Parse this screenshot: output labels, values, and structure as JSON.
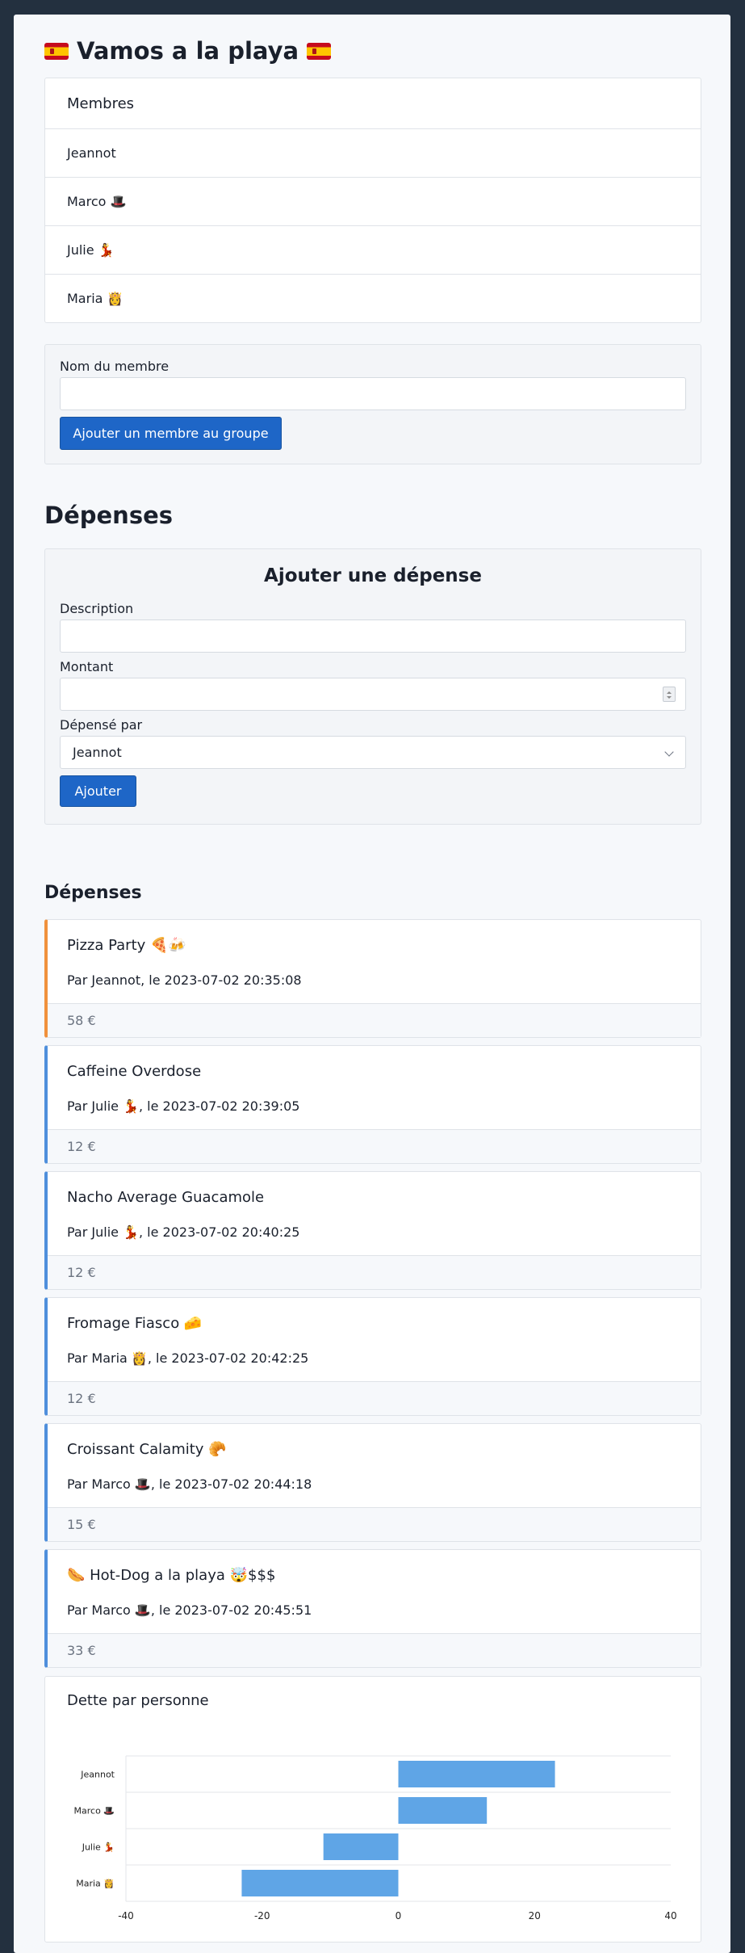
{
  "page_title": "Vamos a la playa",
  "members": {
    "header": "Membres",
    "items": [
      "Jeannot",
      "Marco 🎩",
      "Julie 💃",
      "Maria 👸"
    ]
  },
  "add_member_form": {
    "label": "Nom du membre",
    "input_value": "",
    "button": "Ajouter un membre au groupe"
  },
  "expenses_section_title": "Dépenses",
  "add_expense_form": {
    "title": "Ajouter une dépense",
    "description_label": "Description",
    "description_value": "",
    "amount_label": "Montant",
    "amount_value": "",
    "paid_by_label": "Dépensé par",
    "paid_by_selected": "Jeannot",
    "button": "Ajouter"
  },
  "expense_list_title": "Dépenses",
  "expenses": [
    {
      "title": "Pizza Party 🍕🍻",
      "by": "Par Jeannot, le 2023-07-02 20:35:08",
      "amount": "58 €"
    },
    {
      "title": "Caffeine Overdose",
      "by": "Par Julie 💃, le 2023-07-02 20:39:05",
      "amount": "12 €"
    },
    {
      "title": "Nacho Average Guacamole",
      "by": "Par Julie 💃, le 2023-07-02 20:40:25",
      "amount": "12 €"
    },
    {
      "title": "Fromage Fiasco 🧀",
      "by": "Par Maria 👸, le 2023-07-02 20:42:25",
      "amount": "12 €"
    },
    {
      "title": "Croissant Calamity 🥐",
      "by": "Par Marco 🎩, le 2023-07-02 20:44:18",
      "amount": "15 €"
    },
    {
      "title": "🌭 Hot-Dog a la playa 🤯$$$",
      "by": "Par Marco 🎩, le 2023-07-02 20:45:51",
      "amount": "33 €"
    }
  ],
  "chart_title": "Dette par personne",
  "colors": {
    "bar": "#5fa5e6",
    "accent": "#1e66c7"
  },
  "chart_data": {
    "type": "bar",
    "orientation": "horizontal",
    "title": "Dette par personne",
    "categories": [
      "Jeannot",
      "Marco 🎩",
      "Julie 💃",
      "Maria 👸"
    ],
    "values": [
      23,
      13,
      -11,
      -23
    ],
    "xlim": [
      -40,
      40
    ],
    "xticks": [
      "-40",
      "-20",
      "0",
      "20",
      "40"
    ],
    "grid": true
  }
}
